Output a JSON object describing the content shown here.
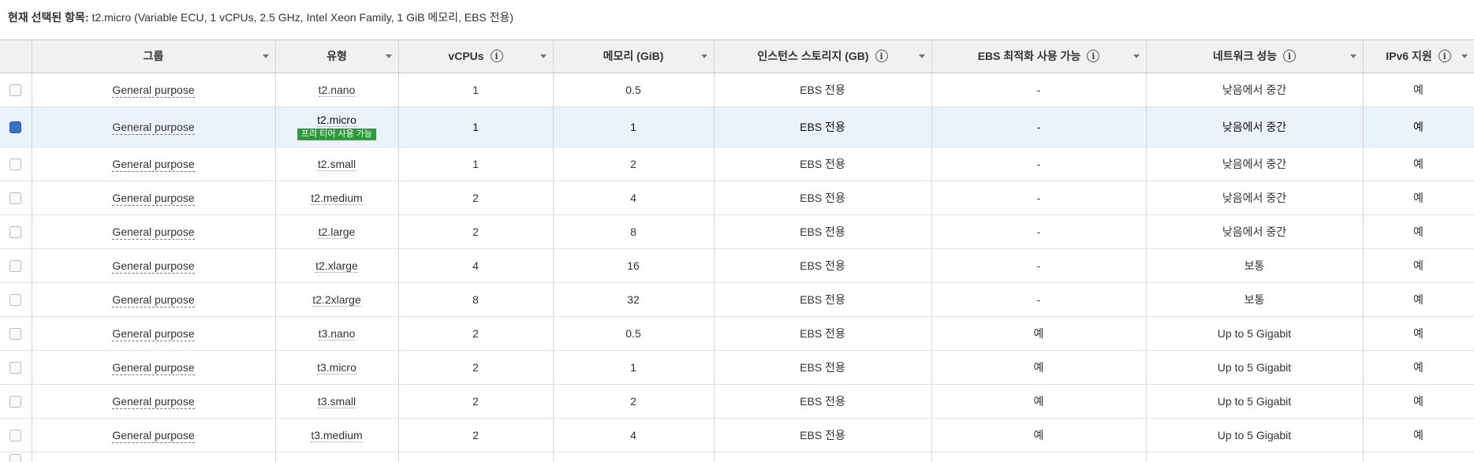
{
  "selection": {
    "label": "현재 선택된 항목:",
    "value": "t2.micro (Variable ECU, 1 vCPUs, 2.5 GHz, Intel Xeon Family, 1 GiB 메모리, EBS 전용)"
  },
  "columns": [
    {
      "label": "",
      "info": false
    },
    {
      "label": "그룹",
      "info": false
    },
    {
      "label": "유형",
      "info": false
    },
    {
      "label": "vCPUs",
      "info": true
    },
    {
      "label": "메모리 (GiB)",
      "info": false
    },
    {
      "label": "인스턴스 스토리지 (GB)",
      "info": true
    },
    {
      "label": "EBS 최적화 사용 가능",
      "info": true
    },
    {
      "label": "네트워크 성능",
      "info": true
    },
    {
      "label": "IPv6 지원",
      "info": true
    }
  ],
  "info_glyph": "i",
  "rows": [
    {
      "checked": false,
      "group": "General purpose",
      "type": "t2.nano",
      "badge": "",
      "vcpus": "1",
      "memory": "0.5",
      "storage": "EBS 전용",
      "ebs": "-",
      "network": "낮음에서 중간",
      "ipv6": "예"
    },
    {
      "checked": true,
      "group": "General purpose",
      "type": "t2.micro",
      "badge": "프리 티어 사용 가능",
      "vcpus": "1",
      "memory": "1",
      "storage": "EBS 전용",
      "ebs": "-",
      "network": "낮음에서 중간",
      "ipv6": "예"
    },
    {
      "checked": false,
      "group": "General purpose",
      "type": "t2.small",
      "badge": "",
      "vcpus": "1",
      "memory": "2",
      "storage": "EBS 전용",
      "ebs": "-",
      "network": "낮음에서 중간",
      "ipv6": "예"
    },
    {
      "checked": false,
      "group": "General purpose",
      "type": "t2.medium",
      "badge": "",
      "vcpus": "2",
      "memory": "4",
      "storage": "EBS 전용",
      "ebs": "-",
      "network": "낮음에서 중간",
      "ipv6": "예"
    },
    {
      "checked": false,
      "group": "General purpose",
      "type": "t2.large",
      "badge": "",
      "vcpus": "2",
      "memory": "8",
      "storage": "EBS 전용",
      "ebs": "-",
      "network": "낮음에서 중간",
      "ipv6": "예"
    },
    {
      "checked": false,
      "group": "General purpose",
      "type": "t2.xlarge",
      "badge": "",
      "vcpus": "4",
      "memory": "16",
      "storage": "EBS 전용",
      "ebs": "-",
      "network": "보통",
      "ipv6": "예"
    },
    {
      "checked": false,
      "group": "General purpose",
      "type": "t2.2xlarge",
      "badge": "",
      "vcpus": "8",
      "memory": "32",
      "storage": "EBS 전용",
      "ebs": "-",
      "network": "보통",
      "ipv6": "예"
    },
    {
      "checked": false,
      "group": "General purpose",
      "type": "t3.nano",
      "badge": "",
      "vcpus": "2",
      "memory": "0.5",
      "storage": "EBS 전용",
      "ebs": "예",
      "network": "Up to 5 Gigabit",
      "ipv6": "예"
    },
    {
      "checked": false,
      "group": "General purpose",
      "type": "t3.micro",
      "badge": "",
      "vcpus": "2",
      "memory": "1",
      "storage": "EBS 전용",
      "ebs": "예",
      "network": "Up to 5 Gigabit",
      "ipv6": "예"
    },
    {
      "checked": false,
      "group": "General purpose",
      "type": "t3.small",
      "badge": "",
      "vcpus": "2",
      "memory": "2",
      "storage": "EBS 전용",
      "ebs": "예",
      "network": "Up to 5 Gigabit",
      "ipv6": "예"
    },
    {
      "checked": false,
      "group": "General purpose",
      "type": "t3.medium",
      "badge": "",
      "vcpus": "2",
      "memory": "4",
      "storage": "EBS 전용",
      "ebs": "예",
      "network": "Up to 5 Gigabit",
      "ipv6": "예"
    }
  ]
}
